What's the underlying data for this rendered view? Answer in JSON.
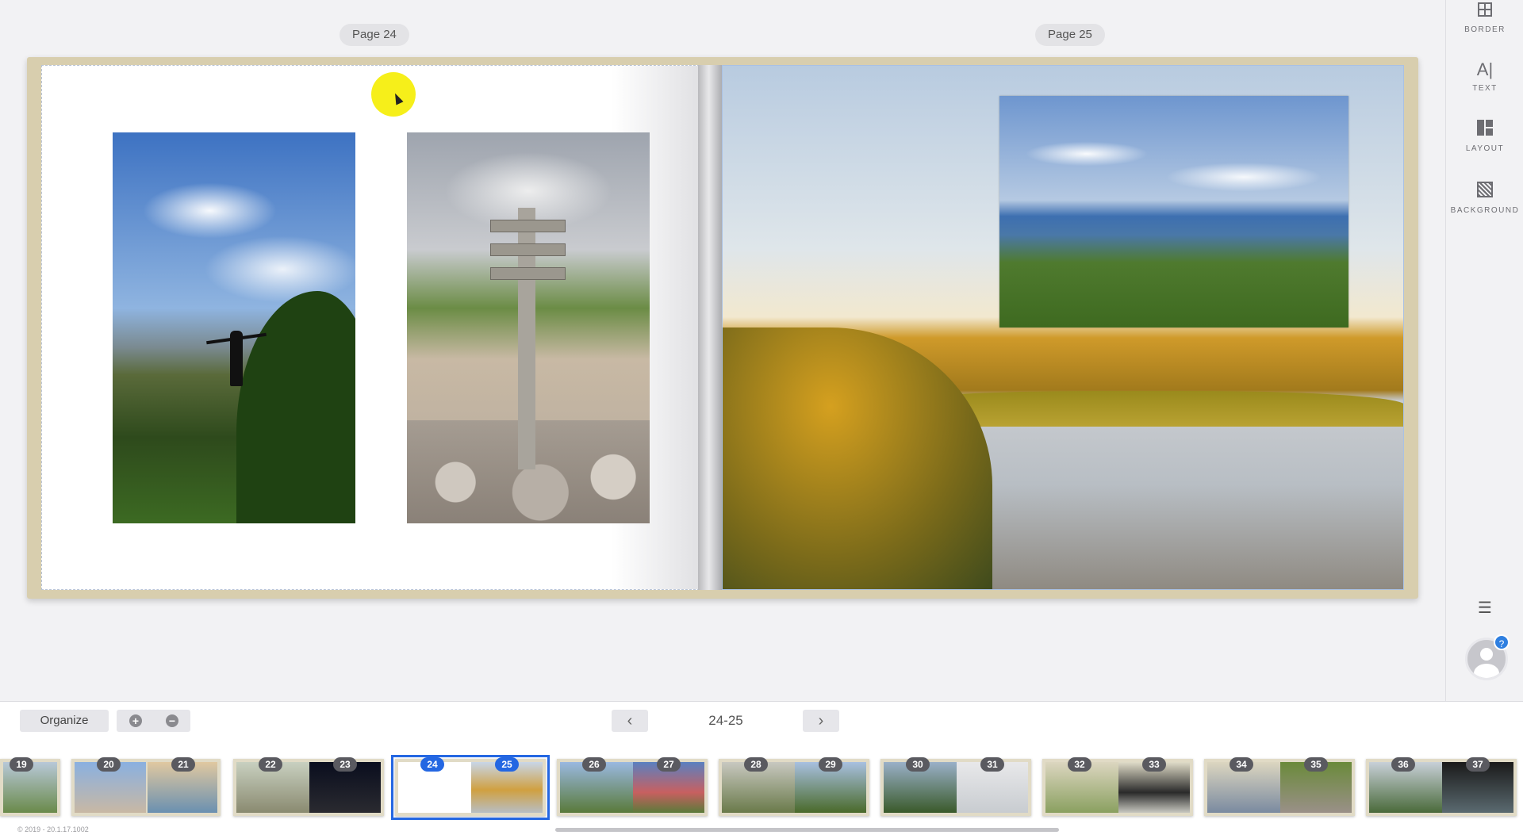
{
  "spread": {
    "left_page_label": "Page 24",
    "right_page_label": "Page 25"
  },
  "toolbar": {
    "border_label": "BORDER",
    "text_label": "TEXT",
    "layout_label": "LAYOUT",
    "background_label": "BACKGROUND",
    "help_badge": "?"
  },
  "bottom": {
    "organize_label": "Organize",
    "zoom_in": "+",
    "zoom_out": "−",
    "prev": "‹",
    "next": "›",
    "page_range": "24-25",
    "version": "© 2019 - 20.1.17.1002"
  },
  "thumbnails": [
    {
      "pages": [
        "19"
      ]
    },
    {
      "pages": [
        "20",
        "21"
      ]
    },
    {
      "pages": [
        "22",
        "23"
      ]
    },
    {
      "pages": [
        "24",
        "25"
      ],
      "selected": true
    },
    {
      "pages": [
        "26",
        "27"
      ]
    },
    {
      "pages": [
        "28",
        "29"
      ]
    },
    {
      "pages": [
        "30",
        "31"
      ]
    },
    {
      "pages": [
        "32",
        "33"
      ]
    },
    {
      "pages": [
        "34",
        "35"
      ]
    },
    {
      "pages": [
        "36",
        "37"
      ]
    }
  ],
  "colors": {
    "accent": "#2467e2",
    "cursor_highlight": "#f6ef1a"
  }
}
